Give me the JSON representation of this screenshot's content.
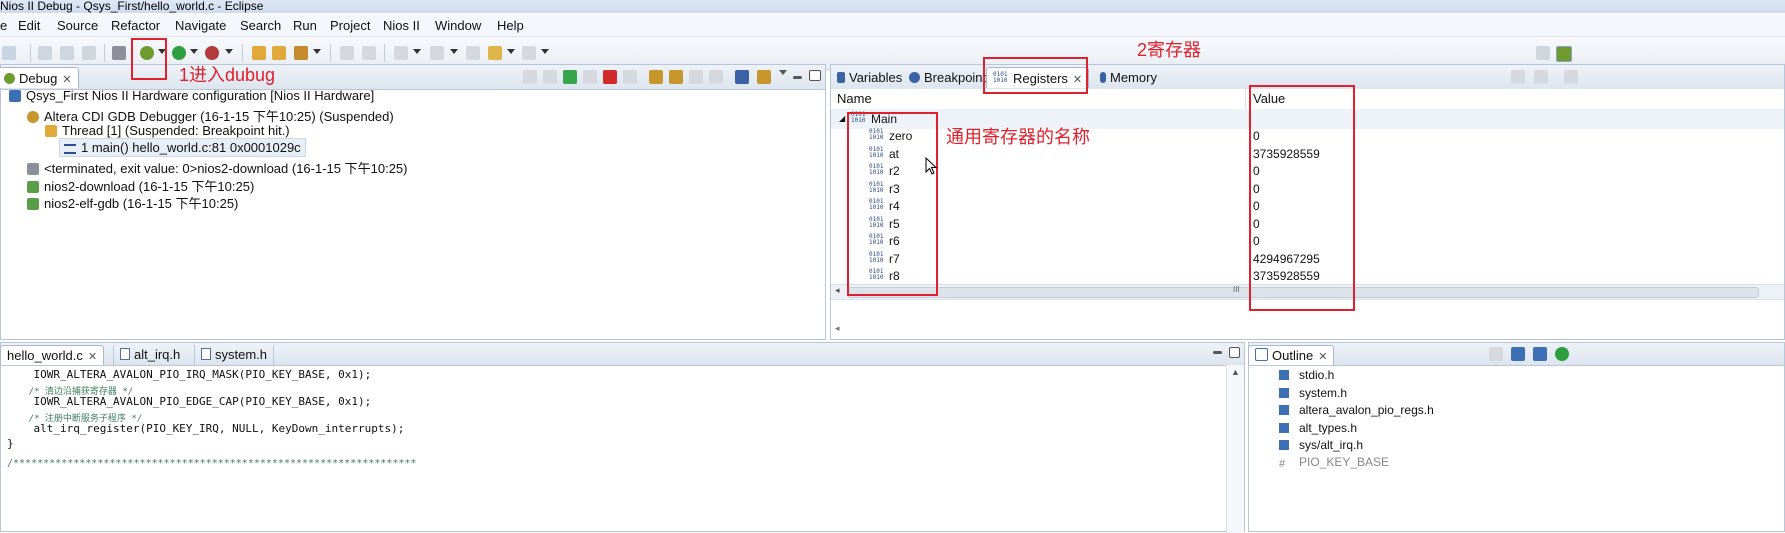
{
  "window": {
    "title": "Nios II Debug - Qsys_First/hello_world.c - Eclipse"
  },
  "menu": [
    "e",
    "Edit",
    "Source",
    "Refactor",
    "Navigate",
    "Search",
    "Run",
    "Project",
    "Nios II",
    "Window",
    "Help"
  ],
  "debug_view": {
    "tab_label": "Debug",
    "tree": [
      "Qsys_First Nios II Hardware configuration [Nios II Hardware]",
      "Altera CDI GDB Debugger (16-1-15 下午10:25) (Suspended)",
      "Thread [1] (Suspended: Breakpoint hit.)",
      "1 main() hello_world.c:81 0x0001029c",
      "<terminated, exit value: 0>nios2-download (16-1-15 下午10:25)",
      "nios2-download (16-1-15 下午10:25)",
      "nios2-elf-gdb (16-1-15 下午10:25)"
    ]
  },
  "registers_view": {
    "tabs": [
      "Variables",
      "Breakpoints",
      "Registers",
      "Memory"
    ],
    "columns": {
      "name": "Name",
      "value": "Value"
    },
    "group": "Main",
    "rows": [
      {
        "name": "zero",
        "value": "0"
      },
      {
        "name": "at",
        "value": "3735928559"
      },
      {
        "name": "r2",
        "value": "0"
      },
      {
        "name": "r3",
        "value": "0"
      },
      {
        "name": "r4",
        "value": "0"
      },
      {
        "name": "r5",
        "value": "0"
      },
      {
        "name": "r6",
        "value": "0"
      },
      {
        "name": "r7",
        "value": "4294967295"
      },
      {
        "name": "r8",
        "value": "3735928559"
      }
    ],
    "scroll_grip": "III"
  },
  "editor": {
    "tabs": [
      "hello_world.c",
      "alt_irq.h",
      "system.h"
    ],
    "lines": [
      "    IOWR_ALTERA_AVALON_PIO_IRQ_MASK(PIO_KEY_BASE, 0x1);",
      "    /* 清边沿捕获寄存器 */",
      "    IOWR_ALTERA_AVALON_PIO_EDGE_CAP(PIO_KEY_BASE, 0x1);",
      "    /* 注册中断服务子程序 */",
      "    alt_irq_register(PIO_KEY_IRQ, NULL, KeyDown_interrupts);",
      "}",
      "",
      "/*******************************************************************"
    ]
  },
  "outline": {
    "tab_label": "Outline",
    "items": [
      "stdio.h",
      "system.h",
      "altera_avalon_pio_regs.h",
      "alt_types.h",
      "sys/alt_irq.h",
      "PIO_KEY_BASE"
    ]
  },
  "annotations": {
    "enter_debug": "1进入dubug",
    "registers": "2寄存器",
    "reg_names": "通用寄存器的名称"
  },
  "colors": {
    "annotation": "#e0202c",
    "selection": "#dbe6f4",
    "icon_blue": "#3c6fb3",
    "icon_green": "#2f9e3e"
  }
}
